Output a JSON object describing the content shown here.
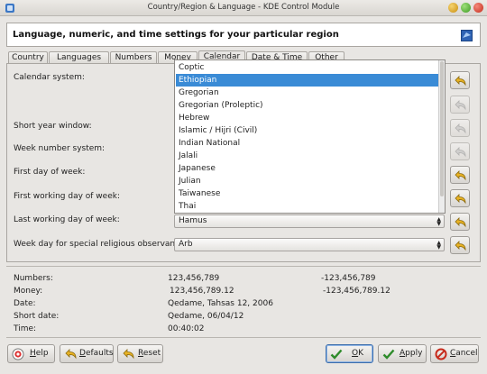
{
  "window": {
    "title": "Country/Region & Language - KDE Control Module"
  },
  "header": {
    "text": "Language, numeric, and time settings for your particular region"
  },
  "tabs": [
    {
      "label": "Country"
    },
    {
      "label": "Languages"
    },
    {
      "label": "Numbers"
    },
    {
      "label": "Money"
    },
    {
      "label": "Calendar"
    },
    {
      "label": "Date & Time"
    },
    {
      "label": "Other"
    }
  ],
  "active_tab": "Calendar",
  "settings": {
    "calendar_system": {
      "label": "Calendar system:"
    },
    "short_year": {
      "label": "Short year window:"
    },
    "week_number": {
      "label": "Week number system:"
    },
    "first_day": {
      "label": "First day of week:"
    },
    "first_working_day": {
      "label": "First working day of week:"
    },
    "last_working_day": {
      "label": "Last working day of week:",
      "value": "Hamus"
    },
    "religious_day": {
      "label": "Week day for special religious observance:",
      "value": "Arb"
    }
  },
  "calendar_dropdown": {
    "items": [
      "Coptic",
      "Ethiopian",
      "Gregorian",
      "Gregorian (Proleptic)",
      "Hebrew",
      "Islamic / Hijri (Civil)",
      "Indian National",
      "Jalali",
      "Japanese",
      "Julian",
      "Taiwanese",
      "Thai"
    ],
    "selected": "Ethiopian"
  },
  "preview": {
    "numbers": {
      "label": "Numbers:",
      "value": "123,456,789",
      "value2": "-123,456,789"
    },
    "money": {
      "label": "Money:",
      "value": "123,456,789.12",
      "value2": "-123,456,789.12"
    },
    "date": {
      "label": "Date:",
      "value": "Qedame, Tahsas 12, 2006"
    },
    "short_date": {
      "label": "Short date:",
      "value": "Qedame, 06/04/12"
    },
    "time": {
      "label": "Time:",
      "value": "00:40:02"
    }
  },
  "buttons": {
    "help": {
      "label_mn": "H",
      "label_rest": "elp"
    },
    "defaults": {
      "label_mn": "D",
      "label_rest": "efaults"
    },
    "reset": {
      "label_mn": "R",
      "label_rest": "eset"
    },
    "ok": {
      "label_mn": "O",
      "label_rest": "K"
    },
    "apply": {
      "label_mn": "A",
      "label_rest": "pply"
    },
    "cancel": {
      "label_mn": "C",
      "label_rest": "ancel"
    }
  },
  "colors": {
    "selection": "#3a8bd6",
    "background": "#e8e6e3"
  },
  "icons": {
    "defaults_buttons": "undo-arrow-icon",
    "ok": "checkmark-icon",
    "apply": "checkmark-icon",
    "cancel": "cancel-icon",
    "help": "help-icon"
  }
}
